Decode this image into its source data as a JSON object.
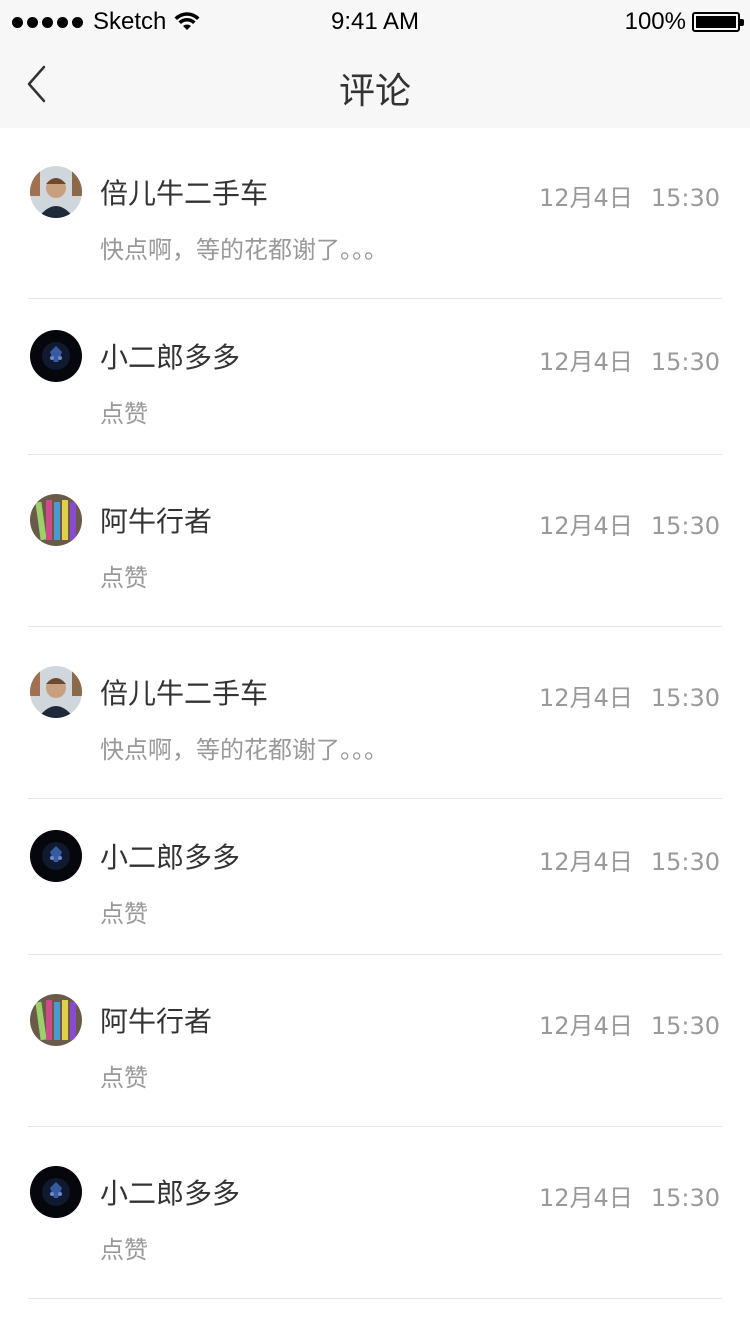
{
  "status_bar": {
    "carrier": "Sketch",
    "time": "9:41 AM",
    "battery": "100%"
  },
  "nav": {
    "title": "评论",
    "back_icon": "chevron-left-icon"
  },
  "comments": [
    {
      "name": "倍儿牛二手车",
      "date": "12月4日",
      "time": "15:30",
      "text": "快点啊，等的花都谢了。。。",
      "avatar": "portrait"
    },
    {
      "name": "小二郎多多",
      "date": "12月4日",
      "time": "15:30",
      "text": "点赞",
      "avatar": "dark"
    },
    {
      "name": "阿牛行者",
      "date": "12月4日",
      "time": "15:30",
      "text": "点赞",
      "avatar": "books"
    },
    {
      "name": "倍儿牛二手车",
      "date": "12月4日",
      "time": "15:30",
      "text": "快点啊，等的花都谢了。。。",
      "avatar": "portrait"
    },
    {
      "name": "小二郎多多",
      "date": "12月4日",
      "time": "15:30",
      "text": "点赞",
      "avatar": "dark"
    },
    {
      "name": "阿牛行者",
      "date": "12月4日",
      "time": "15:30",
      "text": "点赞",
      "avatar": "books"
    },
    {
      "name": "小二郎多多",
      "date": "12月4日",
      "time": "15:30",
      "text": "点赞",
      "avatar": "dark"
    }
  ]
}
